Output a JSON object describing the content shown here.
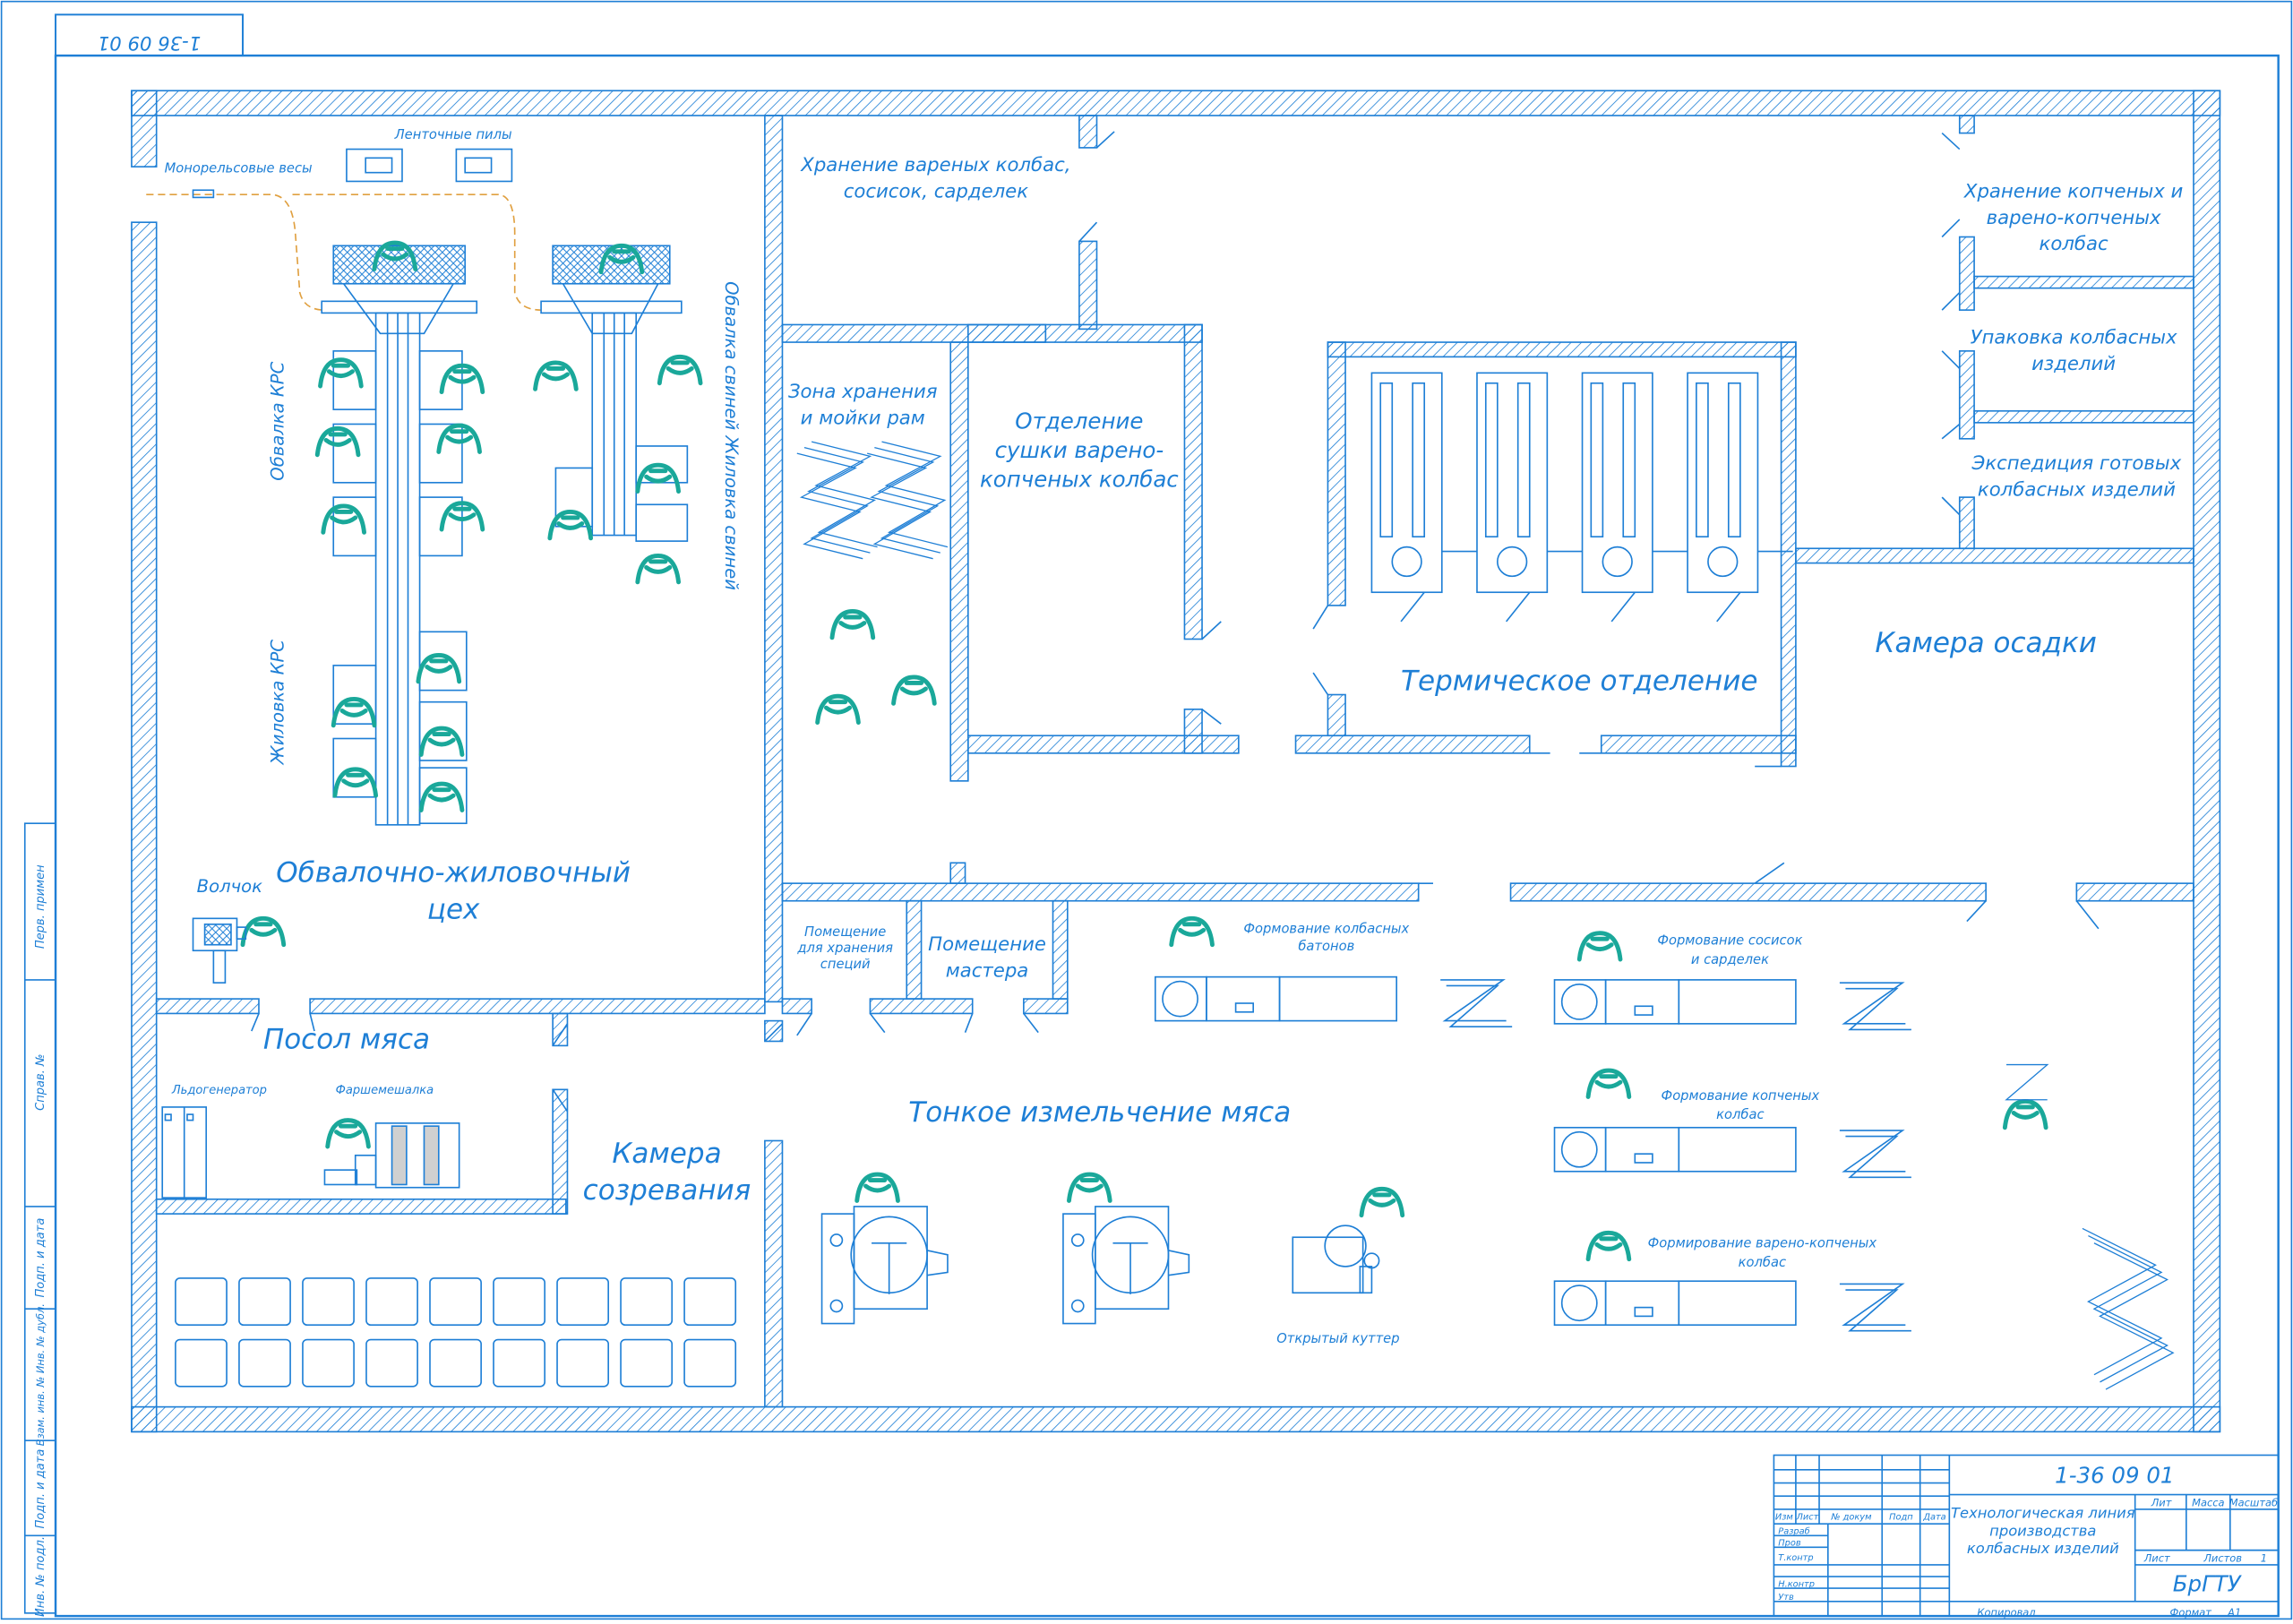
{
  "stamp_top": "1-36 09 01",
  "rooms": {
    "obvalka": "Обвалочно-жиловочный",
    "obvalka2": "цех",
    "monorail": "Монорельсовые весы",
    "saws": "Ленточные пилы",
    "krs_obv": "Обвалка КРС",
    "krs_zhil": "Жиловка КРС",
    "pig": "Обвалка свиней  Жиловка свиней",
    "volchok": "Волчок",
    "posol": "Посол мяса",
    "ice": "Льдогенератор",
    "mixer": "Фаршемешалка",
    "ripen1": "Камера",
    "ripen2": "созревания",
    "boiled1": "Хранение вареных колбас,",
    "boiled2": "сосисок, сарделек",
    "frames1": "Зона хранения",
    "frames2": "и мойки рам",
    "dry1": "Отделение",
    "dry2": "сушки варено-",
    "dry3": "копченых колбас",
    "thermal": "Термическое отделение",
    "settle": "Камера осадки",
    "smoked1": "Хранение копченых и",
    "smoked2": "варено-копченых",
    "smoked3": "колбас",
    "pack1": "Упаковка колбасных",
    "pack2": "изделий",
    "exp1": "Экспедиция готовых",
    "exp2": "колбасных изделий",
    "spice1": "Помещение",
    "spice2": "для хранения",
    "spice3": "специй",
    "master1": "Помещение",
    "master2": "мастера",
    "fine": "Тонкое измельчение мяса",
    "cutter": "Открытый куттер",
    "f1a": "Формование колбасных",
    "f1b": "батонов",
    "f2a": "Формование сосисок",
    "f2b": "и сарделек",
    "f3a": "Формование копченых",
    "f3b": "колбас",
    "f4a": "Формирование варено-копченых",
    "f4b": "колбас"
  },
  "title_block": {
    "code": "1-36 09 01",
    "title1": "Технологическая линия",
    "title2": "производства",
    "title3": "колбасных изделий",
    "org": "БрГТУ",
    "lit": "Лит",
    "mass": "Масса",
    "scale": "Масштаб",
    "sheet": "Лист",
    "sheets": "Листов",
    "sheets_n": "1",
    "izm": "Изм",
    "list": "Лист",
    "doc": "№ докум",
    "podp": "Подп",
    "date": "Дата",
    "razrab": "Разраб",
    "prov": "Пров",
    "tkontr": "Т.контр",
    "nkontr": "Н.контр",
    "utv": "Утв",
    "copied": "Копировал",
    "format": "Формат",
    "format_v": "А1"
  },
  "side_labels": [
    "Перв. примен",
    "Справ. №",
    "Подп. и дата",
    "Взам. инв. № Инв. № дубл.",
    "Подп. и дата",
    "Инв. № подл."
  ]
}
